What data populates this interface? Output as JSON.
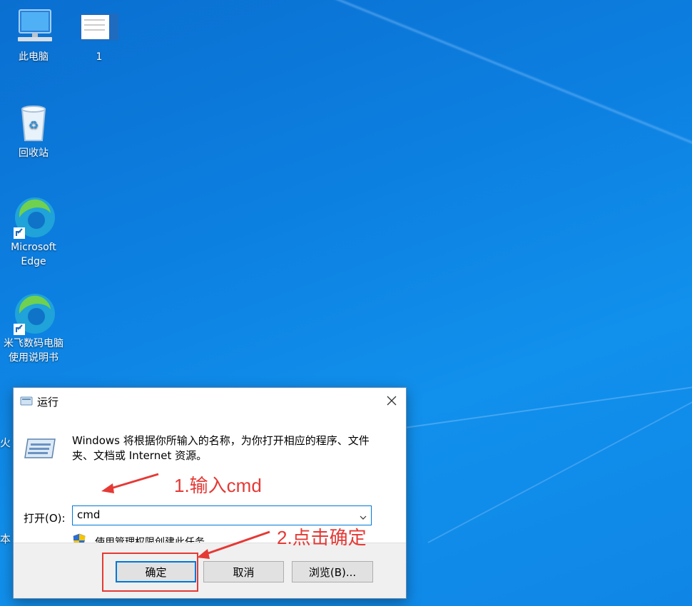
{
  "desktop": {
    "icons": [
      {
        "label": "此电脑"
      },
      {
        "label": "1"
      },
      {
        "label": "回收站"
      },
      {
        "label": "Microsoft Edge"
      },
      {
        "label": "米飞数码电脑使用说明书"
      }
    ],
    "partial_labels": [
      "火",
      "本"
    ]
  },
  "run_dialog": {
    "title": "运行",
    "description": "Windows 将根据你所输入的名称，为你打开相应的程序、文件夹、文档或 Internet 资源。",
    "open_label": "打开(O):",
    "open_value": "cmd",
    "admin_text": "使用管理权限创建此任务。",
    "ok_label": "确定",
    "cancel_label": "取消",
    "browse_label": "浏览(B)..."
  },
  "annotations": {
    "step1": "1.输入cmd",
    "step2": "2.点击确定",
    "color": "#e53935"
  }
}
